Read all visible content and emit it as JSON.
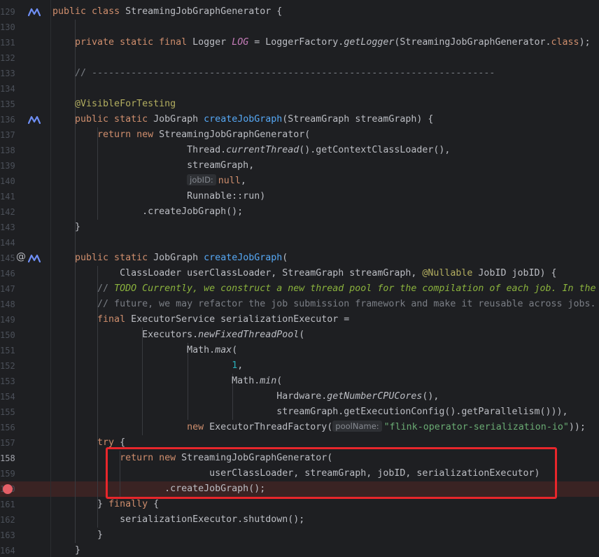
{
  "lines": [
    {
      "n": "129",
      "segs": [
        {
          "c": "kw",
          "t": "public "
        },
        {
          "c": "kw",
          "t": "class "
        },
        {
          "c": "cls",
          "t": "StreamingJobGraphGenerator {"
        }
      ]
    },
    {
      "n": "130",
      "segs": []
    },
    {
      "n": "131",
      "segs": [
        {
          "c": "kw",
          "t": "    private static final "
        },
        {
          "c": "cls",
          "t": "Logger "
        },
        {
          "c": "field",
          "t": "LOG"
        },
        {
          "c": "cls",
          "t": " = LoggerFactory."
        },
        {
          "c": "st",
          "t": "getLogger"
        },
        {
          "c": "cls",
          "t": "(StreamingJobGraphGenerator."
        },
        {
          "c": "kw",
          "t": "class"
        },
        {
          "c": "cls",
          "t": ");"
        }
      ]
    },
    {
      "n": "132",
      "segs": []
    },
    {
      "n": "133",
      "segs": [
        {
          "c": "cmt",
          "t": "    // ------------------------------------------------------------------------"
        }
      ]
    },
    {
      "n": "134",
      "segs": []
    },
    {
      "n": "135",
      "segs": [
        {
          "c": "ann",
          "t": "    @VisibleForTesting"
        }
      ]
    },
    {
      "n": "136",
      "segs": [
        {
          "c": "kw",
          "t": "    public static "
        },
        {
          "c": "cls",
          "t": "JobGraph "
        },
        {
          "c": "fn",
          "t": "createJobGraph"
        },
        {
          "c": "cls",
          "t": "(StreamGraph streamGraph) {"
        }
      ]
    },
    {
      "n": "137",
      "segs": [
        {
          "c": "kw",
          "t": "        return new "
        },
        {
          "c": "cls",
          "t": "StreamingJobGraphGenerator("
        }
      ]
    },
    {
      "n": "138",
      "segs": [
        {
          "c": "cls",
          "t": "                        Thread."
        },
        {
          "c": "st",
          "t": "currentThread"
        },
        {
          "c": "cls",
          "t": "().getContextClassLoader(),"
        }
      ]
    },
    {
      "n": "139",
      "segs": [
        {
          "c": "cls",
          "t": "                        streamGraph,"
        }
      ]
    },
    {
      "n": "140",
      "segs": [
        {
          "c": "cls",
          "t": "                        "
        },
        {
          "c": "hint",
          "t": "jobID:"
        },
        {
          "c": "kw",
          "t": "null"
        },
        {
          "c": "cls",
          "t": ","
        }
      ]
    },
    {
      "n": "141",
      "segs": [
        {
          "c": "cls",
          "t": "                        Runnable::run)"
        }
      ]
    },
    {
      "n": "142",
      "segs": [
        {
          "c": "cls",
          "t": "                .createJobGraph();"
        }
      ]
    },
    {
      "n": "143",
      "segs": [
        {
          "c": "cls",
          "t": "    }"
        }
      ]
    },
    {
      "n": "144",
      "segs": []
    },
    {
      "n": "145",
      "segs": [
        {
          "c": "kw",
          "t": "    public static "
        },
        {
          "c": "cls",
          "t": "JobGraph "
        },
        {
          "c": "fn",
          "t": "createJobGraph"
        },
        {
          "c": "cls",
          "t": "("
        }
      ]
    },
    {
      "n": "146",
      "segs": [
        {
          "c": "cls",
          "t": "            ClassLoader userClassLoader, StreamGraph streamGraph, "
        },
        {
          "c": "ann",
          "t": "@Nullable"
        },
        {
          "c": "cls",
          "t": " JobID jobID) {"
        }
      ]
    },
    {
      "n": "147",
      "segs": [
        {
          "c": "cmt",
          "t": "        // "
        },
        {
          "c": "todo",
          "t": "TODO Currently, we construct a new thread pool for the compilation of each job. In the"
        }
      ]
    },
    {
      "n": "148",
      "segs": [
        {
          "c": "cmt",
          "t": "        // future, we may refactor the job submission framework and make it reusable across jobs."
        }
      ]
    },
    {
      "n": "149",
      "segs": [
        {
          "c": "kw",
          "t": "        final "
        },
        {
          "c": "cls",
          "t": "ExecutorService serializationExecutor ="
        }
      ]
    },
    {
      "n": "150",
      "segs": [
        {
          "c": "cls",
          "t": "                Executors."
        },
        {
          "c": "st",
          "t": "newFixedThreadPool"
        },
        {
          "c": "cls",
          "t": "("
        }
      ]
    },
    {
      "n": "151",
      "segs": [
        {
          "c": "cls",
          "t": "                        Math."
        },
        {
          "c": "st",
          "t": "max"
        },
        {
          "c": "cls",
          "t": "("
        }
      ]
    },
    {
      "n": "152",
      "segs": [
        {
          "c": "cls",
          "t": "                                "
        },
        {
          "c": "num",
          "t": "1"
        },
        {
          "c": "cls",
          "t": ","
        }
      ]
    },
    {
      "n": "153",
      "segs": [
        {
          "c": "cls",
          "t": "                                Math."
        },
        {
          "c": "st",
          "t": "min"
        },
        {
          "c": "cls",
          "t": "("
        }
      ]
    },
    {
      "n": "154",
      "segs": [
        {
          "c": "cls",
          "t": "                                        Hardware."
        },
        {
          "c": "st",
          "t": "getNumberCPUCores"
        },
        {
          "c": "cls",
          "t": "(),"
        }
      ]
    },
    {
      "n": "155",
      "segs": [
        {
          "c": "cls",
          "t": "                                        streamGraph.getExecutionConfig().getParallelism())),"
        }
      ]
    },
    {
      "n": "156",
      "segs": [
        {
          "c": "kw",
          "t": "                        new "
        },
        {
          "c": "cls",
          "t": "ExecutorThreadFactory("
        },
        {
          "c": "hint",
          "t": "poolName:"
        },
        {
          "c": "str",
          "t": "\"flink-operator-serialization-io\""
        },
        {
          "c": "cls",
          "t": "));"
        }
      ]
    },
    {
      "n": "157",
      "segs": [
        {
          "c": "kw",
          "t": "        try "
        },
        {
          "c": "cls",
          "t": "{"
        }
      ]
    },
    {
      "n": "158",
      "segs": [
        {
          "c": "kw",
          "t": "            return new "
        },
        {
          "c": "cls",
          "t": "StreamingJobGraphGenerator("
        }
      ]
    },
    {
      "n": "159",
      "segs": [
        {
          "c": "cls",
          "t": "                            userClassLoader, streamGraph, jobID, serializationExecutor)"
        }
      ]
    },
    {
      "n": "160",
      "segs": [
        {
          "c": "cls",
          "t": "                    .createJobGraph();"
        }
      ]
    },
    {
      "n": "161",
      "segs": [
        {
          "c": "cls",
          "t": "        } "
        },
        {
          "c": "kw",
          "t": "finally "
        },
        {
          "c": "cls",
          "t": "{"
        }
      ]
    },
    {
      "n": "162",
      "segs": [
        {
          "c": "cls",
          "t": "            serializationExecutor.shutdown();"
        }
      ]
    },
    {
      "n": "163",
      "segs": [
        {
          "c": "cls",
          "t": "        }"
        }
      ]
    },
    {
      "n": "164",
      "segs": [
        {
          "c": "cls",
          "t": "    }"
        }
      ]
    }
  ],
  "gutter_markers": {
    "implements_icon": "implements-icon",
    "override_icon": "at-override-icon",
    "override_glyph": "@",
    "breakpoint_icon": "breakpoint-icon"
  },
  "colors": {
    "background": "#1e1f22",
    "keyword": "#cf8e6d",
    "method": "#56a8f5",
    "comment": "#7a7e85",
    "string": "#6aab73",
    "number": "#2aacb8",
    "annotation": "#b3ae60",
    "highlight_box": "#e8262b",
    "breakpoint": "#e55f67"
  }
}
